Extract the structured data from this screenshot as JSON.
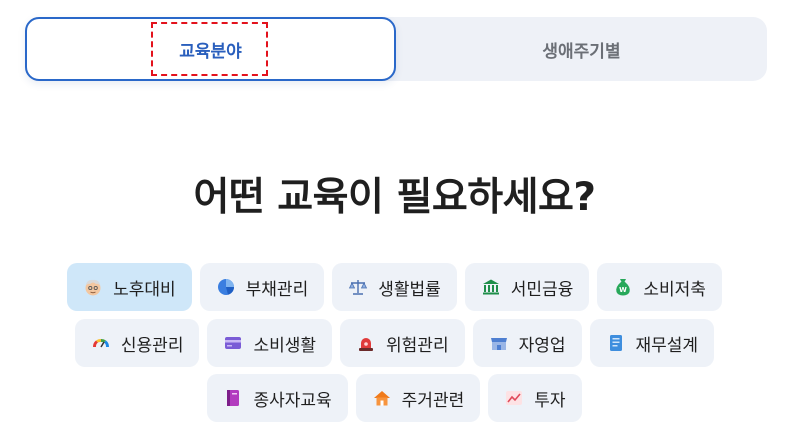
{
  "tabs": [
    {
      "label": "교육분야"
    },
    {
      "label": "생애주기별"
    }
  ],
  "heading": "어떤 교육이 필요하세요?",
  "categories": [
    {
      "label": "노후대비",
      "icon": "elderly-face-icon"
    },
    {
      "label": "부채관리",
      "icon": "pie-chart-icon"
    },
    {
      "label": "생활법률",
      "icon": "balance-scale-icon"
    },
    {
      "label": "서민금융",
      "icon": "bank-icon"
    },
    {
      "label": "소비저축",
      "icon": "money-bag-icon"
    },
    {
      "label": "신용관리",
      "icon": "gauge-icon"
    },
    {
      "label": "소비생활",
      "icon": "credit-card-icon"
    },
    {
      "label": "위험관리",
      "icon": "siren-icon"
    },
    {
      "label": "자영업",
      "icon": "store-icon"
    },
    {
      "label": "재무설계",
      "icon": "document-icon"
    },
    {
      "label": "종사자교육",
      "icon": "book-icon"
    },
    {
      "label": "주거관련",
      "icon": "house-icon"
    },
    {
      "label": "투자",
      "icon": "trend-chart-icon"
    }
  ],
  "colors": {
    "accent": "#2a68c9",
    "focus_outline": "#e3121c",
    "chip_bg": "#eef2f8",
    "chip_selected_bg": "#cfe7f9"
  }
}
